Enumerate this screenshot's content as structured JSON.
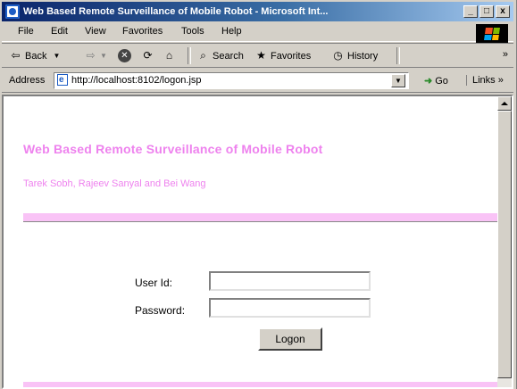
{
  "window": {
    "title": "Web Based Remote Surveillance of Mobile Robot - Microsoft Int...",
    "minimize_label": "_",
    "restore_label": "□",
    "close_label": "x"
  },
  "menu": {
    "items": [
      {
        "label": "File"
      },
      {
        "label": "Edit"
      },
      {
        "label": "View"
      },
      {
        "label": "Favorites"
      },
      {
        "label": "Tools"
      },
      {
        "label": "Help"
      }
    ]
  },
  "toolbar": {
    "back_label": "Back",
    "search_label": "Search",
    "favorites_label": "Favorites",
    "history_label": "History",
    "more_label": "»"
  },
  "address": {
    "label": "Address",
    "url": "http://localhost:8102/logon.jsp",
    "go_label": "Go",
    "links_label": "Links »"
  },
  "page": {
    "title": "Web Based Remote Surveillance of Mobile Robot",
    "authors": "Tarek Sobh, Rajeev Sanyal and Bei Wang",
    "form": {
      "user_id_label": "User Id:",
      "user_id_value": "",
      "password_label": "Password:",
      "password_value": "",
      "logon_label": "Logon"
    }
  },
  "colors": {
    "title_pink": "#ee82ee",
    "band_pink": "#f9c3f6",
    "titlebar_start": "#0a246a",
    "titlebar_end": "#a6caf0"
  },
  "icons": {
    "app": "ie-icon",
    "back": "back-arrow-icon",
    "forward": "forward-arrow-icon",
    "stop": "stop-icon",
    "refresh": "refresh-icon",
    "home": "home-icon",
    "search": "search-icon",
    "favorites": "favorites-icon",
    "history": "history-icon"
  }
}
